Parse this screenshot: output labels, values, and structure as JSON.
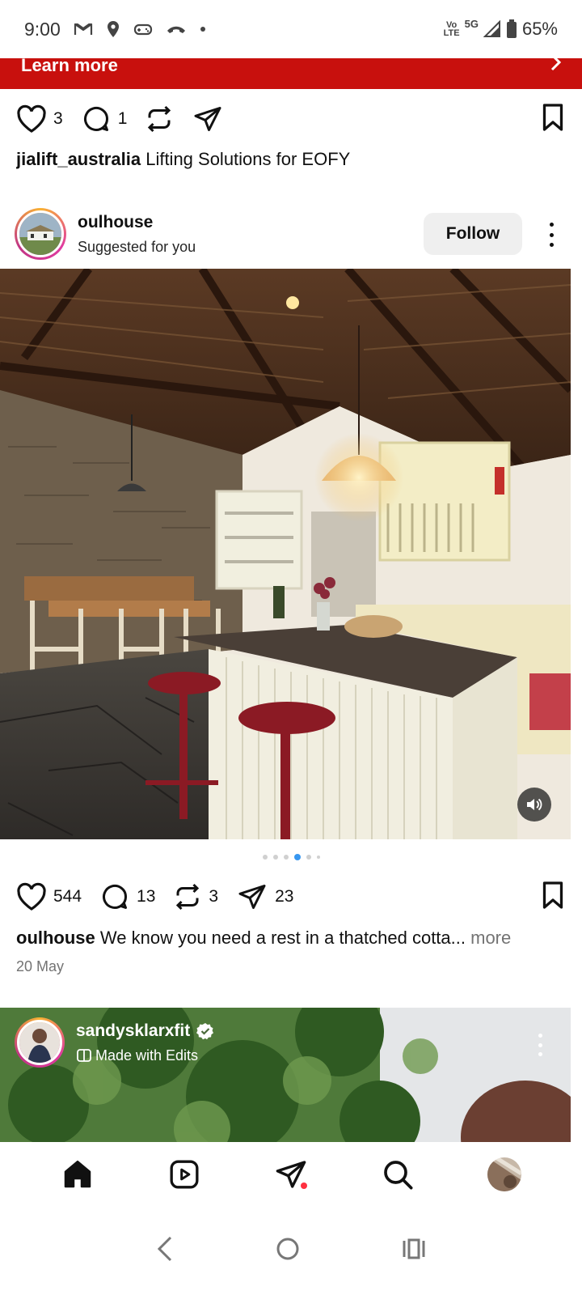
{
  "status_bar": {
    "time": "9:00",
    "network_top": "Vo",
    "network_bottom": "LTE",
    "network_type": "5G",
    "battery": "65%",
    "icons": [
      "gmail-icon",
      "location-icon",
      "gamepad-icon",
      "missed-call-icon",
      "dot-icon",
      "wifi-calling-icon",
      "signal-icon",
      "battery-icon"
    ]
  },
  "ad": {
    "cta_label": "Learn more",
    "color": "#c8100d"
  },
  "previous_post": {
    "likes": "3",
    "comments": "1",
    "username": "jialift_australia",
    "caption": "Lifting Solutions for EOFY"
  },
  "post": {
    "username": "oulhouse",
    "subtitle": "Suggested for you",
    "follow_label": "Follow",
    "carousel": {
      "count": 6,
      "active_index": 3
    },
    "likes": "544",
    "comments": "13",
    "reposts": "3",
    "shares": "23",
    "caption": "We know you need a rest in a thatched cotta...",
    "more_label": "more",
    "date": "20 May"
  },
  "next_post": {
    "username": "sandysklarxfit",
    "verified": true,
    "subtitle": "Made with Edits"
  },
  "bottom_nav": [
    "home-icon",
    "reels-icon",
    "messages-icon",
    "search-icon",
    "profile-avatar"
  ],
  "colors": {
    "accent_blue": "#3897f0",
    "notification_red": "#ff3040"
  }
}
